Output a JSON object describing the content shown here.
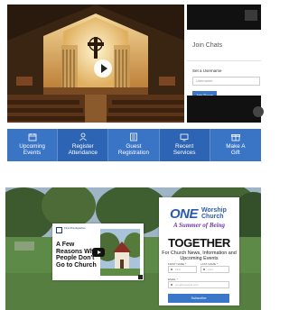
{
  "video": {
    "play_icon": "play-icon"
  },
  "chat": {
    "title": "Join Chats",
    "username_label": "Set a Username",
    "username_placeholder": "Username",
    "join_button": "Join Room"
  },
  "quick_links": [
    {
      "icon": "calendar-icon",
      "line1": "Upcoming",
      "line2": "Events"
    },
    {
      "icon": "person-icon",
      "line1": "Register",
      "line2": "Attendance"
    },
    {
      "icon": "form-icon",
      "line1": "Guest",
      "line2": "Registration"
    },
    {
      "icon": "tv-icon",
      "line1": "Recent",
      "line2": "Services"
    },
    {
      "icon": "gift-icon",
      "line1": "Make A",
      "line2": "Gift"
    }
  ],
  "promo": {
    "logo_text": "First Presbyterian",
    "title": "A Few Reasons Why People Don't Go to Church"
  },
  "signup": {
    "brand_one": "ONE",
    "brand_worship": "Worship",
    "brand_church": "Church",
    "tagline": "A Summer of Being",
    "headline": "TOGETHER",
    "subheading": "For Church News, Information and Upcoming Events",
    "first_name_label": "FIRST NAME *",
    "first_name_placeholder": "First",
    "last_name_label": "LAST NAME *",
    "last_name_placeholder": "Last",
    "email_label": "EMAIL *",
    "email_placeholder": "you@example.com",
    "subscribe_button": "Subscribe"
  },
  "colors": {
    "accent_blue": "#3a74c4",
    "button_blue": "#3a77c8",
    "brand_blue": "#2a5ab0",
    "tagline_purple": "#6a3aa0"
  }
}
